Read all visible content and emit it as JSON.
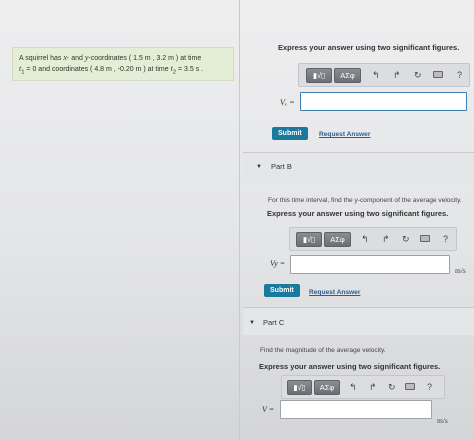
{
  "problem": {
    "line1_a": "A squirrel has ",
    "line1_x": "x",
    "line1_b": "- and ",
    "line1_y": "y",
    "line1_c": "-coordinates ( 1.5 m , 3.2 m ) at time",
    "line2_t1": "t",
    "line2_a": "1",
    "line2_b": " = 0 and coordinates ( 4.8 m , -0.20 m ) at time ",
    "line2_t2": "t",
    "line2_c": "2",
    "line2_d": " = 3.5 s ."
  },
  "toolbar": {
    "template_label": "▮√▯",
    "greek_label": "ΑΣφ",
    "undo_icon": "↰",
    "redo_icon": "↱",
    "reset_icon": "↻",
    "help_icon": "?"
  },
  "partA": {
    "instruction": "Express your answer using two significant figures.",
    "label": "Vₓ =",
    "submit": "Submit",
    "request": "Request Answer"
  },
  "partB": {
    "title": "Part B",
    "question": "For this time interval, find the y-component of the average velocity.",
    "instruction": "Express your answer using two significant figures.",
    "label": "Vy =",
    "unit": "m/s",
    "submit": "Submit",
    "request": "Request Answer"
  },
  "partC": {
    "title": "Part C",
    "question": "Find the magnitude of the average velocity.",
    "instruction": "Express your answer using two significant figures.",
    "label": "V =",
    "unit": "m/s"
  }
}
